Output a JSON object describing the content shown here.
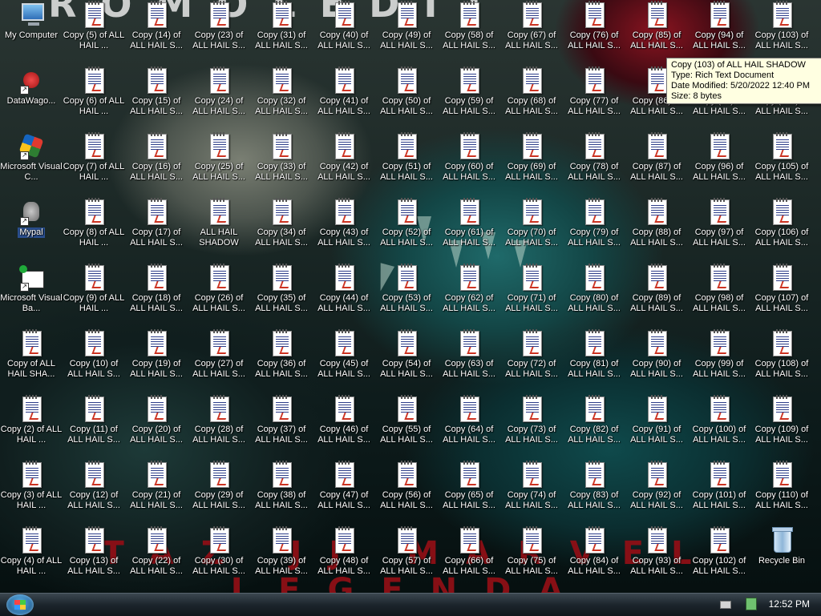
{
  "desktop": {
    "system_icons": [
      {
        "label": "My Computer",
        "icon": "computer-icon"
      },
      {
        "label": "DataWago...",
        "icon": "datawago-icon"
      },
      {
        "label": "Microsoft Visual C...",
        "icon": "visual-c-icon"
      },
      {
        "label": "Mypal",
        "icon": "mypal-icon"
      },
      {
        "label": "Microsoft Visual Ba...",
        "icon": "visual-basic-icon"
      },
      {
        "label": "Copy of ALL HAIL SHA...",
        "icon": "rtf-document-icon"
      },
      {
        "label": "Copy (2) of ALL HAIL ...",
        "icon": "rtf-document-icon"
      },
      {
        "label": "Copy (3) of ALL HAIL ...",
        "icon": "rtf-document-icon"
      },
      {
        "label": "Copy (4) of ALL HAIL ...",
        "icon": "rtf-document-icon"
      }
    ],
    "document_columns": [
      [
        "Copy (5) of ALL HAIL ...",
        "Copy (6) of ALL HAIL ...",
        "Copy (7) of ALL HAIL ...",
        "Copy (8) of ALL HAIL ...",
        "Copy (9) of ALL HAIL ...",
        "Copy (10) of ALL HAIL S...",
        "Copy (11) of ALL HAIL S...",
        "Copy (12) of ALL HAIL S...",
        "Copy (13) of ALL HAIL S..."
      ],
      [
        "Copy (14) of ALL HAIL S...",
        "Copy (15) of ALL HAIL S...",
        "Copy (16) of ALL HAIL S...",
        "Copy (17) of ALL HAIL S...",
        "Copy (18) of ALL HAIL S...",
        "Copy (19) of ALL HAIL S...",
        "Copy (20) of ALL HAIL S...",
        "Copy (21) of ALL HAIL S...",
        "Copy (22) of ALL HAIL S..."
      ],
      [
        "Copy (23) of ALL HAIL S...",
        "Copy (24) of ALL HAIL S...",
        "Copy (25) of ALL HAIL S...",
        "ALL HAIL SHADOW",
        "Copy (26) of ALL HAIL S...",
        "Copy (27) of ALL HAIL S...",
        "Copy (28) of ALL HAIL S...",
        "Copy (29) of ALL HAIL S...",
        "Copy (30) of ALL HAIL S..."
      ],
      [
        "Copy (31) of ALL HAIL S...",
        "Copy (32) of ALL HAIL S...",
        "Copy (33) of ALL HAIL S...",
        "Copy (34) of ALL HAIL S...",
        "Copy (35) of ALL HAIL S...",
        "Copy (36) of ALL HAIL S...",
        "Copy (37) of ALL HAIL S...",
        "Copy (38) of ALL HAIL S...",
        "Copy (39) of ALL HAIL S..."
      ],
      [
        "Copy (40) of ALL HAIL S...",
        "Copy (41) of ALL HAIL S...",
        "Copy (42) of ALL HAIL S...",
        "Copy (43) of ALL HAIL S...",
        "Copy (44) of ALL HAIL S...",
        "Copy (45) of ALL HAIL S...",
        "Copy (46) of ALL HAIL S...",
        "Copy (47) of ALL HAIL S...",
        "Copy (48) of ALL HAIL S..."
      ],
      [
        "Copy (49) of ALL HAIL S...",
        "Copy (50) of ALL HAIL S...",
        "Copy (51) of ALL HAIL S...",
        "Copy (52) of ALL HAIL S...",
        "Copy (53) of ALL HAIL S...",
        "Copy (54) of ALL HAIL S...",
        "Copy (55) of ALL HAIL S...",
        "Copy (56) of ALL HAIL S...",
        "Copy (57) of ALL HAIL S..."
      ],
      [
        "Copy (58) of ALL HAIL S...",
        "Copy (59) of ALL HAIL S...",
        "Copy (60) of ALL HAIL S...",
        "Copy (61) of ALL HAIL S...",
        "Copy (62) of ALL HAIL S...",
        "Copy (63) of ALL HAIL S...",
        "Copy (64) of ALL HAIL S...",
        "Copy (65) of ALL HAIL S...",
        "Copy (66) of ALL HAIL S..."
      ],
      [
        "Copy (67) of ALL HAIL S...",
        "Copy (68) of ALL HAIL S...",
        "Copy (69) of ALL HAIL S...",
        "Copy (70) of ALL HAIL S...",
        "Copy (71) of ALL HAIL S...",
        "Copy (72) of ALL HAIL S...",
        "Copy (73) of ALL HAIL S...",
        "Copy (74) of ALL HAIL S...",
        "Copy (75) of ALL HAIL S..."
      ],
      [
        "Copy (76) of ALL HAIL S...",
        "Copy (77) of ALL HAIL S...",
        "Copy (78) of ALL HAIL S...",
        "Copy (79) of ALL HAIL S...",
        "Copy (80) of ALL HAIL S...",
        "Copy (81) of ALL HAIL S...",
        "Copy (82) of ALL HAIL S...",
        "Copy (83) of ALL HAIL S...",
        "Copy (84) of ALL HAIL S..."
      ],
      [
        "Copy (85) of ALL HAIL S...",
        "Copy (86) of ALL HAIL S...",
        "Copy (87) of ALL HAIL S...",
        "Copy (88) of ALL HAIL S...",
        "Copy (89) of ALL HAIL S...",
        "Copy (90) of ALL HAIL S...",
        "Copy (91) of ALL HAIL S...",
        "Copy (92) of ALL HAIL S...",
        "Copy (93) of ALL HAIL S..."
      ],
      [
        "Copy (94) of ALL HAIL S...",
        "Copy (95) of ALL HAIL S...",
        "Copy (96) of ALL HAIL S...",
        "Copy (97) of ALL HAIL S...",
        "Copy (98) of ALL HAIL S...",
        "Copy (99) of ALL HAIL S...",
        "Copy (100) of ALL HAIL S...",
        "Copy (101) of ALL HAIL S...",
        "Copy (102) of ALL HAIL S..."
      ],
      [
        "Copy (103) of ALL HAIL S...",
        "Copy (104) of ALL HAIL S...",
        "Copy (105) of ALL HAIL S...",
        "Copy (106) of ALL HAIL S...",
        "Copy (107) of ALL HAIL S...",
        "Copy (108) of ALL HAIL S...",
        "Copy (109) of ALL HAIL S...",
        "Copy (110) of ALL HAIL S...",
        "Recycle Bin"
      ]
    ],
    "selected_label": "Mypal",
    "wallpaper_top_text": "ROMOLEDIT",
    "wallpaper_band_text": "TAZ JJ MARVEL LEGENDA"
  },
  "tooltip": {
    "line1": "Copy (103) of ALL HAIL SHADOW",
    "line2": "Type: Rich Text Document",
    "line3": "Date Modified: 5/20/2022 12:40 PM",
    "line4": "Size: 8 bytes"
  },
  "taskbar": {
    "clock": "12:52 PM",
    "start_icon": "windows-orb-icon",
    "tray_icons": [
      "keyboard-icon",
      "network-icon"
    ]
  }
}
